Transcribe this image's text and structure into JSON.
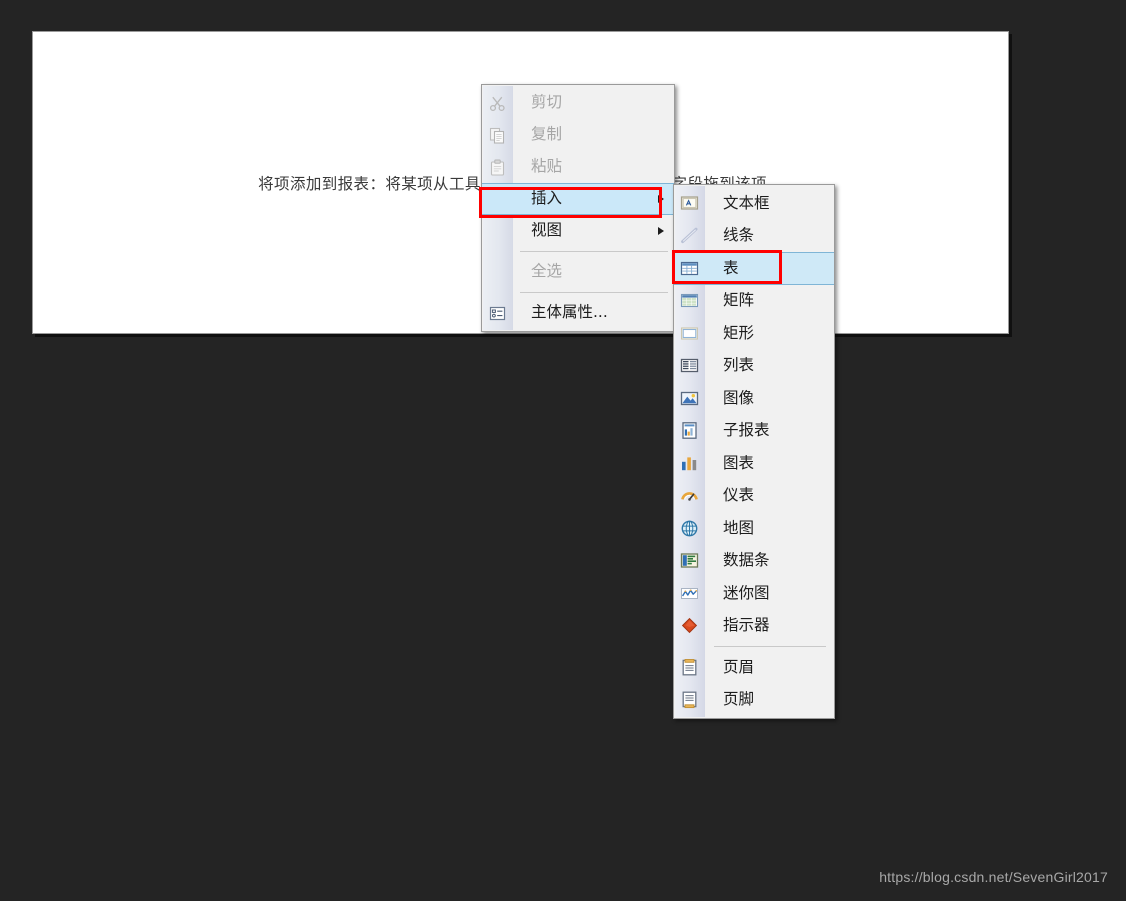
{
  "surface": {
    "hint_text": "将项添加到报表：将某项从工具箱拖到该区域，或将数据集字段拖到该项。"
  },
  "context_menu": {
    "items": [
      {
        "label": "剪切",
        "icon": "scissors-icon",
        "disabled": true,
        "submenu": false,
        "selected": false
      },
      {
        "label": "复制",
        "icon": "copy-icon",
        "disabled": true,
        "submenu": false,
        "selected": false
      },
      {
        "label": "粘贴",
        "icon": "paste-icon",
        "disabled": true,
        "submenu": false,
        "selected": false
      },
      {
        "label": "插入",
        "icon": "none",
        "disabled": false,
        "submenu": true,
        "selected": true
      },
      {
        "label": "视图",
        "icon": "none",
        "disabled": false,
        "submenu": true,
        "selected": false
      },
      {
        "label": "全选",
        "icon": "none",
        "disabled": true,
        "submenu": false,
        "selected": false
      },
      {
        "label": "主体属性...",
        "icon": "properties-icon",
        "disabled": false,
        "submenu": false,
        "selected": false
      }
    ],
    "separator_after": [
      4,
      5
    ]
  },
  "insert_submenu": {
    "items": [
      {
        "label": "文本框",
        "icon": "textbox-icon",
        "selected": false
      },
      {
        "label": "线条",
        "icon": "line-icon",
        "selected": false
      },
      {
        "label": "表",
        "icon": "table-icon",
        "selected": true
      },
      {
        "label": "矩阵",
        "icon": "matrix-icon",
        "selected": false
      },
      {
        "label": "矩形",
        "icon": "rectangle-icon",
        "selected": false
      },
      {
        "label": "列表",
        "icon": "list-icon",
        "selected": false
      },
      {
        "label": "图像",
        "icon": "image-icon",
        "selected": false
      },
      {
        "label": "子报表",
        "icon": "subreport-icon",
        "selected": false
      },
      {
        "label": "图表",
        "icon": "chart-icon",
        "selected": false
      },
      {
        "label": "仪表",
        "icon": "gauge-icon",
        "selected": false
      },
      {
        "label": "地图",
        "icon": "map-icon",
        "selected": false
      },
      {
        "label": "数据条",
        "icon": "databar-icon",
        "selected": false
      },
      {
        "label": "迷你图",
        "icon": "sparkline-icon",
        "selected": false
      },
      {
        "label": "指示器",
        "icon": "indicator-icon",
        "selected": false
      },
      {
        "label": "页眉",
        "icon": "header-icon",
        "selected": false
      },
      {
        "label": "页脚",
        "icon": "footer-icon",
        "selected": false
      }
    ],
    "separator_after": [
      13
    ]
  },
  "annotations": [
    {
      "name": "insert-highlight",
      "target": "插入",
      "color": "#ff0000"
    },
    {
      "name": "table-highlight",
      "target": "表",
      "color": "#ff0000"
    }
  ],
  "watermark": {
    "text": "https://blog.csdn.net/SevenGirl2017"
  },
  "colors": {
    "background": "#242424",
    "surface": "#ffffff",
    "menu_bg": "#f1f1f1",
    "selection": "#cbe8f9",
    "annotation": "#ff0000"
  }
}
